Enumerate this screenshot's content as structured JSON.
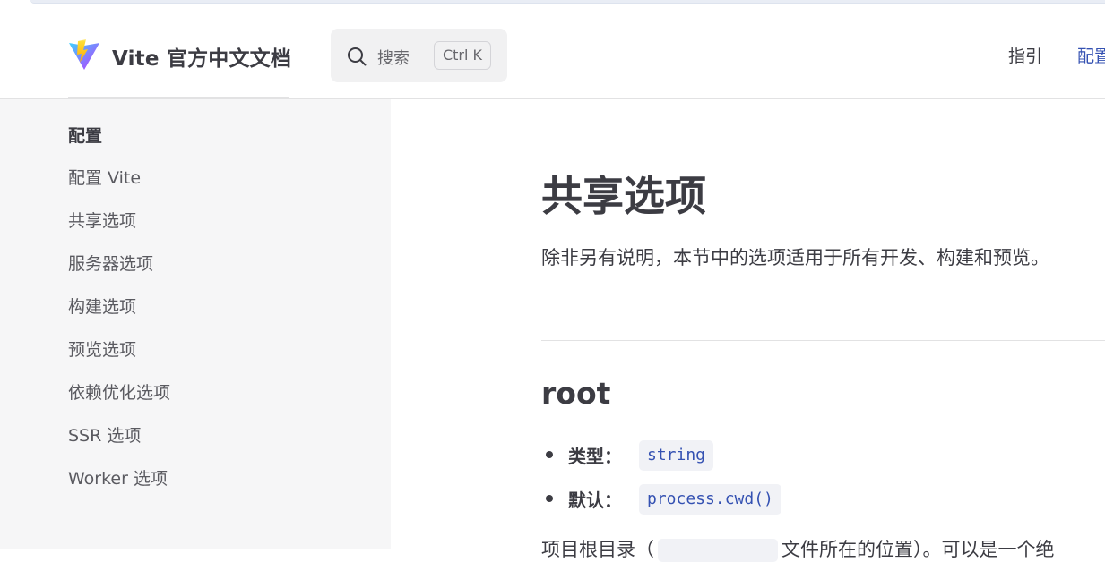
{
  "header": {
    "site_title": "Vite 官方中文文档",
    "search": {
      "label": "搜索",
      "shortcut": "Ctrl K"
    },
    "nav": {
      "guide": "指引",
      "config": "配置"
    }
  },
  "sidebar": {
    "heading": "配置",
    "items": [
      "配置 Vite",
      "共享选项",
      "服务器选项",
      "构建选项",
      "预览选项",
      "依赖优化选项",
      "SSR 选项",
      "Worker 选项"
    ]
  },
  "main": {
    "title": "共享选项",
    "description": "除非另有说明，本节中的选项适用于所有开发、构建和预览。",
    "section": {
      "heading": "root",
      "props": [
        {
          "label": "类型：",
          "value": "string"
        },
        {
          "label": "默认：",
          "value": "process.cwd()"
        }
      ],
      "partial_text_start": "项目根目录（",
      "partial_text_end": "文件所在的位置）。可以是一个绝"
    }
  },
  "colors": {
    "brand": "#3451b2",
    "text": "#3c3c43",
    "sidebar_bg": "#f6f6f7",
    "code_bg": "#f1f2f6"
  },
  "icons": {
    "logo": "vite-logo-icon",
    "search": "search-icon"
  }
}
